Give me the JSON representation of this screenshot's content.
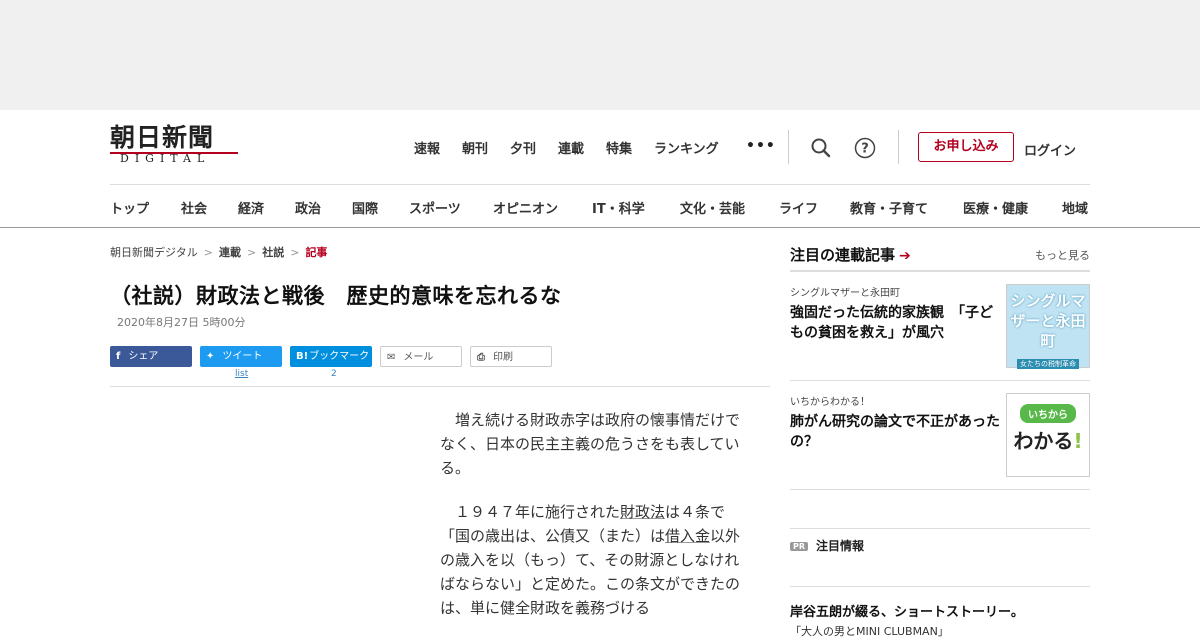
{
  "logo": {
    "jp": "朝日新聞",
    "en": "DIGITAL"
  },
  "top_nav": [
    "速報",
    "朝刊",
    "夕刊",
    "連載",
    "特集",
    "ランキング"
  ],
  "more_label": "•••",
  "header": {
    "signup": "お申し込み",
    "login": "ログイン"
  },
  "categories": [
    "トップ",
    "社会",
    "経済",
    "政治",
    "国際",
    "スポーツ",
    "オピニオン",
    "IT・科学",
    "文化・芸能",
    "ライフ",
    "教育・子育て",
    "医療・健康",
    "地域"
  ],
  "breadcrumb": [
    "朝日新聞デジタル",
    "連載",
    "社説",
    "記事"
  ],
  "article": {
    "title": "（社説）財政法と戦後　歴史的意味を忘れるな",
    "date": "2020年8月27日 5時00分",
    "p1": "増え続ける財政赤字は政府の懐事情だけでなく、日本の民主主義の危うさをも表している。",
    "p2a": "１９４７年に施行された",
    "p2link1": "財政法",
    "p2b": "は４条で「国の歳出は、公債又（また）は",
    "p2link2": "借入金",
    "p2c": "以外の歳入を以（もっ）て、その財源としなければならない」と定めた。この条文ができたのは、単に健全財政を義務づける"
  },
  "share": {
    "facebook": "シェア",
    "twitter": "ツイート",
    "twitter_count": "list",
    "hatena": "ブックマーク",
    "hatena_count": "2",
    "mail": "メール",
    "print": "印刷"
  },
  "sidebar": {
    "heading": "注目の連載記事",
    "more": "もっと見る",
    "cards": [
      {
        "kicker": "シングルマザーと永田町",
        "title": "強固だった伝統的家族観　「子どもの貧困を救え」が風穴",
        "thumb_title": "シングルマザーと永田町",
        "thumb_sub": "女たちの税制革命"
      },
      {
        "kicker": "いちからわかる！",
        "title": "肺がん研究の論文で不正があったの？",
        "thumb_badge": "いちから",
        "thumb_main": "わかる",
        "thumb_mark": "!"
      }
    ],
    "pr_badge": "PR",
    "pr_heading": "注目情報",
    "pr_title": "岸谷五朗が綴る、ショートストーリー。",
    "pr_sub": "「大人の男とMINI CLUBMAN」"
  },
  "colors": {
    "brand_red": "#b4001e",
    "facebook": "#3b5998",
    "twitter": "#1d9bf0",
    "hatena": "#008fde"
  }
}
